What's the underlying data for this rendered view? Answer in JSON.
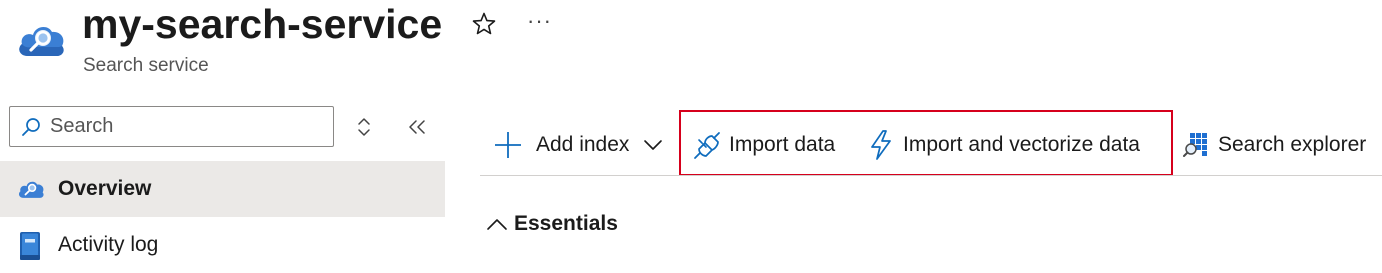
{
  "header": {
    "title": "my-search-service",
    "subtitle": "Search service",
    "icon": "search-service-cloud-icon",
    "favorite_icon": "star-icon",
    "more_glyph": "···"
  },
  "nav": {
    "search": {
      "placeholder": "Search",
      "value": ""
    },
    "items": [
      {
        "label": "Overview",
        "icon": "search-service-cloud-icon",
        "active": true
      },
      {
        "label": "Activity log",
        "icon": "activity-log-icon",
        "active": false
      }
    ]
  },
  "toolbar": {
    "add_index": "Add index",
    "import_data": "Import data",
    "import_vectorize": "Import and vectorize data",
    "search_explorer": "Search explorer"
  },
  "essentials": {
    "label": "Essentials",
    "expanded": true
  },
  "colors": {
    "accent": "#0f6cbd",
    "highlight_border": "#d6001c",
    "active_nav_bg": "#ebe9e7"
  }
}
